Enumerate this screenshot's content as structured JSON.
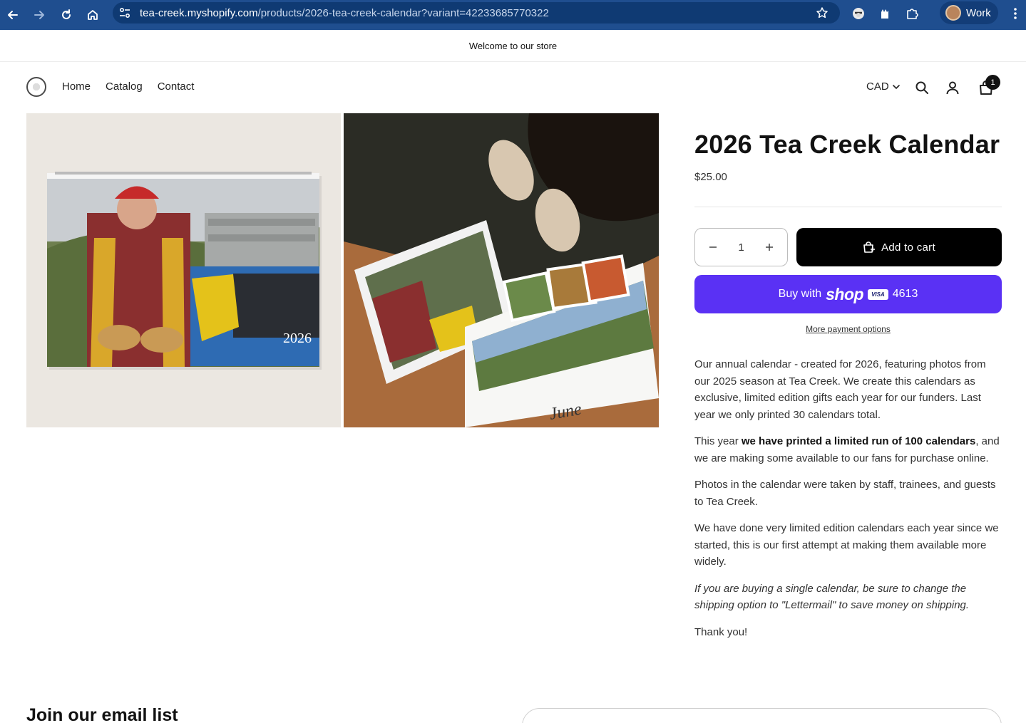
{
  "browser": {
    "url_domain": "tea-creek.myshopify.com",
    "url_path": "/products/2026-tea-creek-calendar?variant=42233685770322",
    "profile_name": "Work"
  },
  "announcement": "Welcome to our store",
  "header": {
    "nav": [
      "Home",
      "Catalog",
      "Contact"
    ],
    "currency": "CAD",
    "cart_count": "1"
  },
  "product": {
    "title": "2026 Tea Creek Calendar",
    "price": "$25.00",
    "quantity": "1",
    "add_to_cart": "Add to cart",
    "buy_with": "Buy with",
    "shop_word": "shop",
    "visa": "VISA",
    "card_last4": "4613",
    "more_payment": "More payment options",
    "image1_year": "2026",
    "image2_month": "June",
    "description": {
      "p1": "Our annual calendar - created for 2026, featuring photos from our 2025 season at Tea Creek. We create this calendars as exclusive, limited edition gifts each year for our funders. Last year we only printed 30 calendars total.",
      "p2_pre": "This year ",
      "p2_bold": "we have printed a limited run of 100 calendars",
      "p2_post": ", and we are making some available to our fans for purchase online.",
      "p3": "Photos in the calendar were taken by staff, trainees, and guests to Tea Creek.",
      "p4": "We have done very limited edition calendars each year since we started, this is our first attempt at making them available more widely.",
      "p5": "If you are buying a single calendar, be sure to change the shipping option to \"Lettermail\" to save money on shipping.",
      "p6": "Thank you!"
    }
  },
  "footer": {
    "email_title": "Join our email list"
  }
}
